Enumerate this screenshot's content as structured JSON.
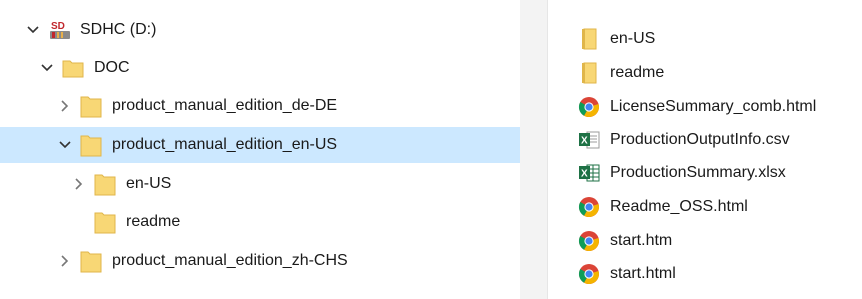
{
  "tree": {
    "drive": {
      "label": "SDHC (D:)",
      "icon": "sd-card-drive-icon",
      "expanded": true
    },
    "doc": {
      "label": "DOC",
      "icon": "folder-icon",
      "expanded": true
    },
    "items": [
      {
        "label": "product_manual_edition_de-DE",
        "icon": "folder-icon",
        "expanded": false,
        "selected": false
      },
      {
        "label": "product_manual_edition_en-US",
        "icon": "folder-icon",
        "expanded": true,
        "selected": true
      },
      {
        "label": "en-US",
        "icon": "folder-icon",
        "expanded": false,
        "selected": false
      },
      {
        "label": "readme",
        "icon": "folder-icon",
        "expanded": null,
        "selected": false
      },
      {
        "label": "product_manual_edition_zh-CHS",
        "icon": "folder-icon",
        "expanded": false,
        "selected": false
      }
    ]
  },
  "files": [
    {
      "name": "en-US",
      "icon": "folder-icon"
    },
    {
      "name": "readme",
      "icon": "folder-icon"
    },
    {
      "name": "LicenseSummary_comb.html",
      "icon": "chrome-html-icon"
    },
    {
      "name": "ProductionOutputInfo.csv",
      "icon": "excel-csv-icon"
    },
    {
      "name": "ProductionSummary.xlsx",
      "icon": "excel-xlsx-icon"
    },
    {
      "name": "Readme_OSS.html",
      "icon": "chrome-html-icon"
    },
    {
      "name": "start.htm",
      "icon": "chrome-html-icon"
    },
    {
      "name": "start.html",
      "icon": "chrome-html-icon"
    }
  ],
  "colors": {
    "selection": "#cce8ff",
    "folder": "#f8d775",
    "folder_dark": "#e0b64a",
    "excel_green": "#1e7145"
  }
}
